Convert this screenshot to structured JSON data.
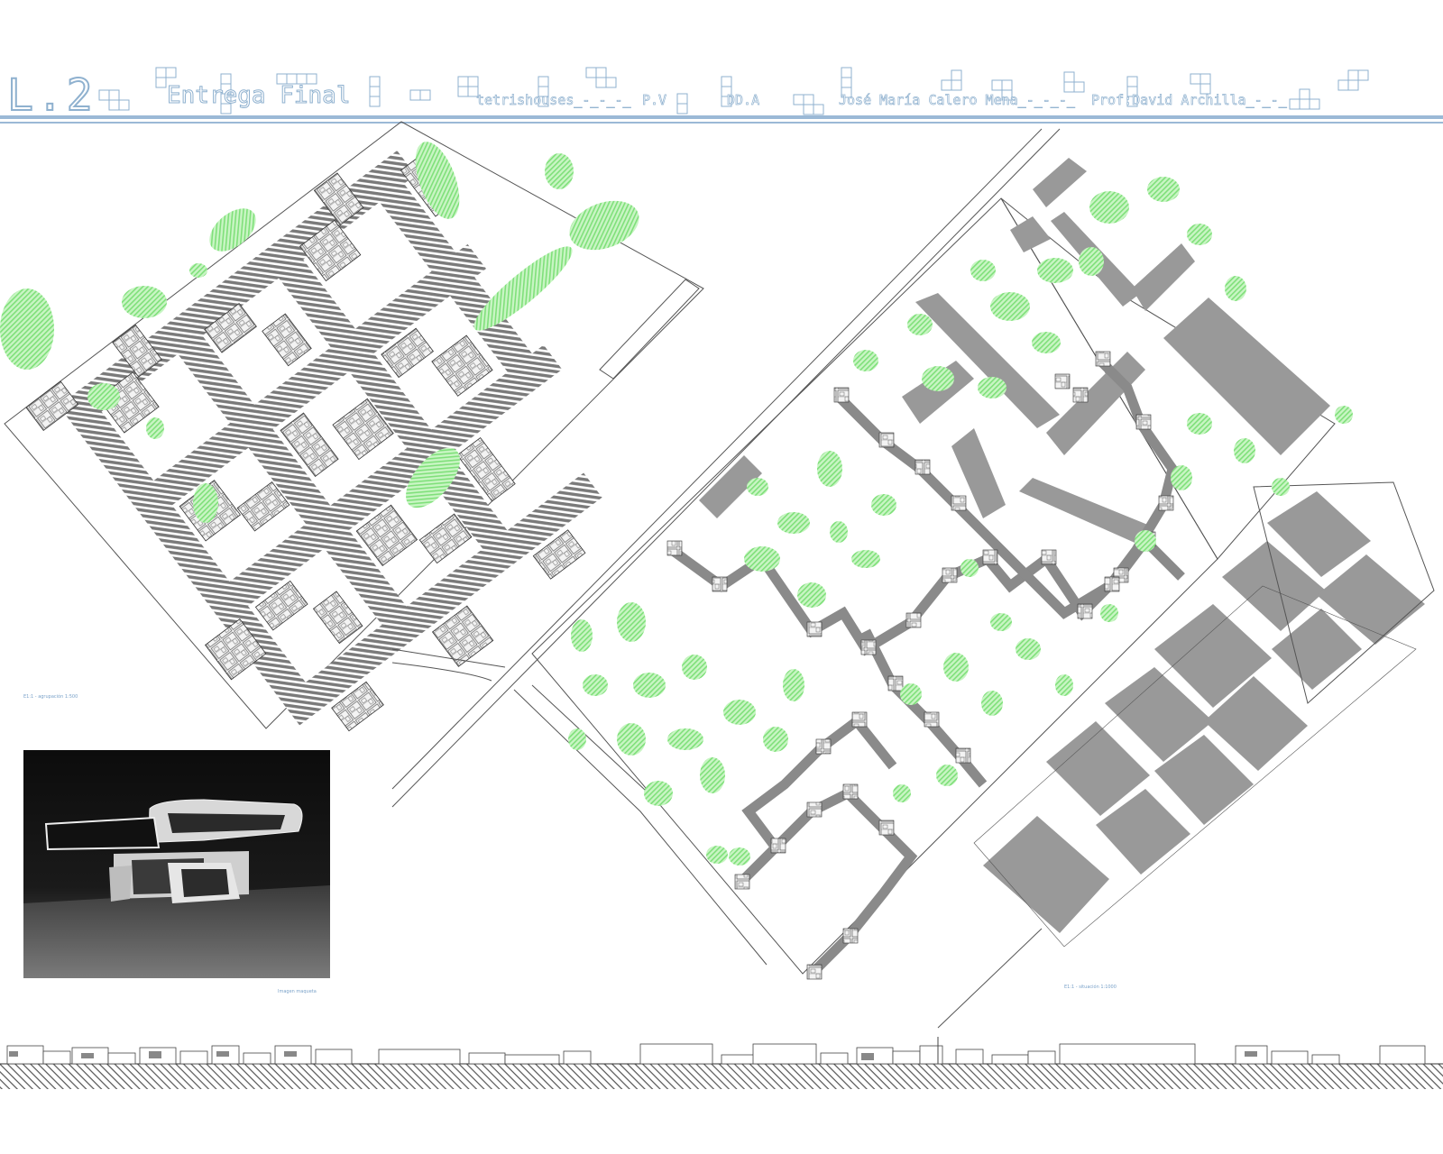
{
  "header": {
    "sheet_number": "L.2",
    "title": "Entrega Final",
    "project": "tetrishouses_-_-_-_",
    "course": "P.V",
    "department": "DD.A",
    "author": "José María Calero Mena_-_-_-_",
    "professor": "Prof:David Archilla_-_-_"
  },
  "captions": {
    "left_plan": "E1:1 - agrupación 1:500",
    "site_plan": "E1:1 - situación 1:1000",
    "photo": "Imagen maqueta"
  },
  "colors": {
    "accent_blue": "#8fb1cf",
    "vegetation_green": "#7fe07a",
    "building_gray": "#999999",
    "hatch_gray": "#7a7a7a"
  },
  "images": {
    "model_photo": "black-and-white photograph of a white architectural model"
  }
}
